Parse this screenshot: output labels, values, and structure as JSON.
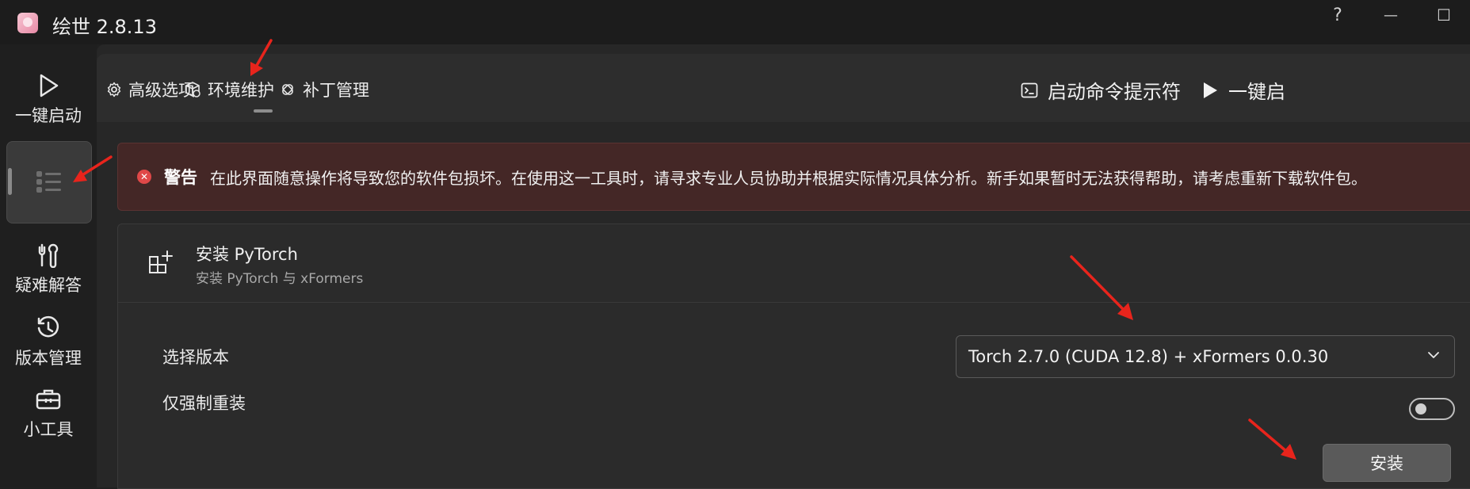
{
  "app": {
    "title": "绘世 2.8.13",
    "help_glyph": "?",
    "minimize_glyph": "—",
    "maximize_glyph": "☐"
  },
  "sidebar": {
    "items": [
      {
        "label": "一键启动",
        "icon": "play-icon"
      },
      {
        "label": "",
        "icon": "list-icon",
        "active": true
      },
      {
        "label": "疑难解答",
        "icon": "tools-icon"
      },
      {
        "label": "版本管理",
        "icon": "history-icon"
      },
      {
        "label": "小工具",
        "icon": "toolbox-icon"
      }
    ]
  },
  "tabs": [
    {
      "label": "高级选项",
      "icon": "gear-icon"
    },
    {
      "label": "环境维护",
      "icon": "package-icon",
      "active": true
    },
    {
      "label": "补丁管理",
      "icon": "patch-icon"
    }
  ],
  "commands": {
    "terminal_label": "启动命令提示符",
    "launch_label": "一键启"
  },
  "warning": {
    "title": "警告",
    "text": "在此界面随意操作将导致您的软件包损坏。在使用这一工具时，请寻求专业人员协助并根据实际情况具体分析。新手如果暂时无法获得帮助，请考虑重新下载软件包。"
  },
  "card": {
    "title": "安装 PyTorch",
    "subtitle": "安装 PyTorch 与 xFormers",
    "version_label": "选择版本",
    "version_value": "Torch 2.7.0 (CUDA 12.8) + xFormers 0.0.30",
    "reinstall_label": "仅强制重装",
    "reinstall_on": false,
    "install_button": "安装"
  },
  "colors": {
    "accent_warning": "#e04848",
    "annotation_arrow": "#e8241c"
  }
}
